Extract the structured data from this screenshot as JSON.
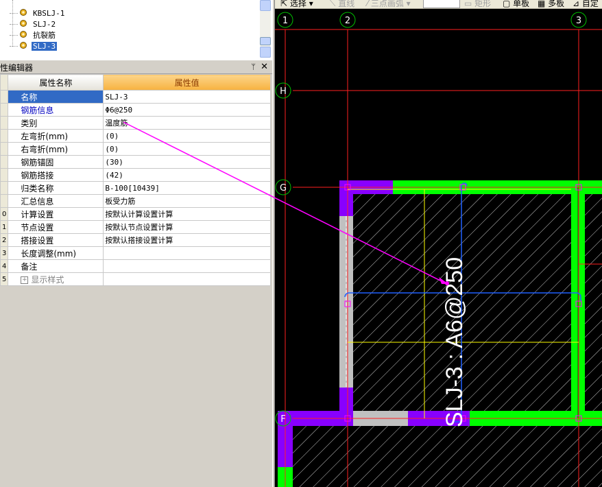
{
  "tree": {
    "items": [
      {
        "label": "KBSLJ-1",
        "selected": false
      },
      {
        "label": "SLJ-2",
        "selected": false
      },
      {
        "label": "抗裂筋",
        "selected": false
      },
      {
        "label": "SLJ-3",
        "selected": true
      }
    ]
  },
  "property_editor": {
    "title": "性编辑器",
    "pin_icon": "pin-icon",
    "close_icon": "close-icon",
    "header": {
      "name": "属性名称",
      "value": "属性值"
    },
    "rows": [
      {
        "idx": "",
        "name": "名称",
        "value": "SLJ-3",
        "style": "selected"
      },
      {
        "idx": "",
        "name": "钢筋信息",
        "value": "Φ6@250",
        "style": "blue"
      },
      {
        "idx": "",
        "name": "类别",
        "value": "温度筋",
        "style": ""
      },
      {
        "idx": "",
        "name": "左弯折(mm)",
        "value": "(0)",
        "style": ""
      },
      {
        "idx": "",
        "name": "右弯折(mm)",
        "value": "(0)",
        "style": ""
      },
      {
        "idx": "",
        "name": "钢筋锚固",
        "value": "(30)",
        "style": ""
      },
      {
        "idx": "",
        "name": "钢筋搭接",
        "value": "(42)",
        "style": ""
      },
      {
        "idx": "",
        "name": "归类名称",
        "value": "B-100[10439]",
        "style": ""
      },
      {
        "idx": "",
        "name": "汇总信息",
        "value": "板受力筋",
        "style": ""
      },
      {
        "idx": "0",
        "name": "计算设置",
        "value": "按默认计算设置计算",
        "style": ""
      },
      {
        "idx": "1",
        "name": "节点设置",
        "value": "按默认节点设置计算",
        "style": ""
      },
      {
        "idx": "2",
        "name": "搭接设置",
        "value": "按默认搭接设置计算",
        "style": ""
      },
      {
        "idx": "3",
        "name": "长度调整(mm)",
        "value": "",
        "style": ""
      },
      {
        "idx": "4",
        "name": "备注",
        "value": "",
        "style": ""
      },
      {
        "idx": "5",
        "name": "显示样式",
        "value": "",
        "style": "gray",
        "expander": "+"
      }
    ]
  },
  "toolbar": {
    "select_label": "选择",
    "line_label": "直线",
    "arc_label": "三点画弧",
    "rect_label": "矩形",
    "single_board_label": "单板",
    "multi_board_label": "多板",
    "custom_label": "自定"
  },
  "cad": {
    "axis_labels": {
      "col1": "1",
      "col2": "2",
      "col3": "3",
      "rowH": "H",
      "rowG": "G",
      "rowF": "F"
    },
    "rebar_label": "SLJ-3 : A6@250",
    "colors": {
      "green": "#00ff00",
      "purple": "#8800ff",
      "red": "#ff2020",
      "yellow": "#ffff00",
      "blue": "#2060ff",
      "magenta": "#ff00ff"
    }
  }
}
